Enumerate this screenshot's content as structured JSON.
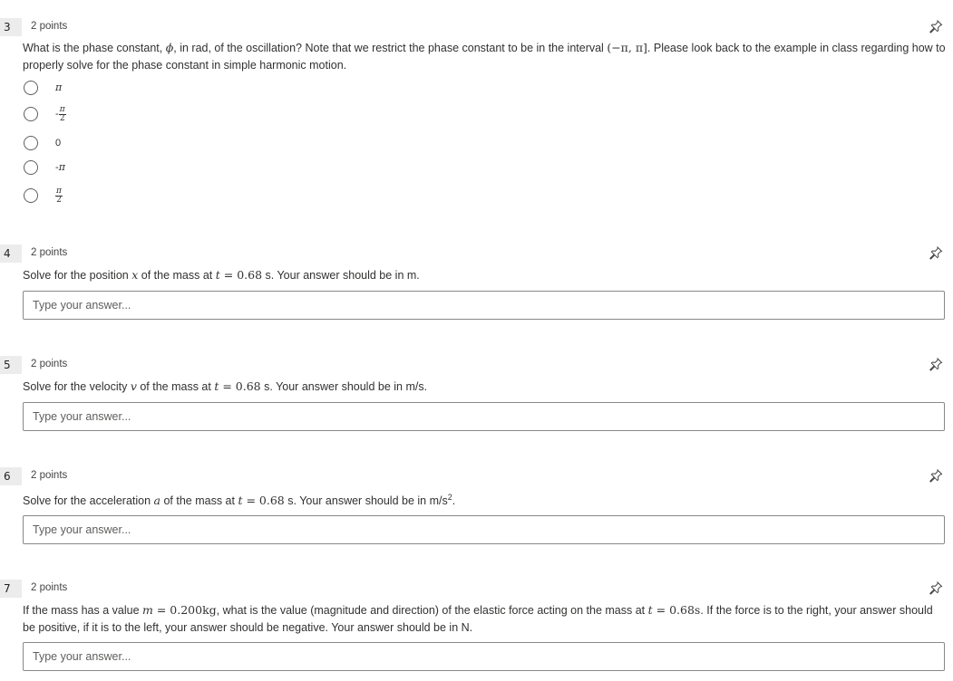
{
  "q3": {
    "number": "3",
    "points": "2 points",
    "text_pre": "What is the phase constant, ",
    "phi": "ϕ",
    "text_mid": ", in rad, of the oscillation? Note that we restrict the phase constant to be in the interval ",
    "interval": "(−π, π]",
    "text_post": ". Please look back to the example in class regarding how to properly solve for the phase constant in simple harmonic motion.",
    "options": {
      "a": {
        "label": "π"
      },
      "b": {
        "sign": "-",
        "num": "π",
        "den": "2"
      },
      "c": {
        "label": "0"
      },
      "d": {
        "label": "-π"
      },
      "e": {
        "num": "π",
        "den": "2"
      }
    }
  },
  "q4": {
    "number": "4",
    "points": "2 points",
    "text_pre": "Solve for the position ",
    "var": "x",
    "text_mid": " of the mass at ",
    "t": "t",
    "eq": " = 0.68",
    "text_post": " s. Your answer should be in m.",
    "placeholder": "Type your answer..."
  },
  "q5": {
    "number": "5",
    "points": "2 points",
    "text_pre": "Solve for the velocity ",
    "var": "v",
    "text_mid": " of the mass at ",
    "t": "t",
    "eq": " = 0.68",
    "text_post": " s. Your answer should be in m/s.",
    "placeholder": "Type your answer..."
  },
  "q6": {
    "number": "6",
    "points": "2 points",
    "text_pre": "Solve for the acceleration ",
    "var": "a",
    "text_mid": " of the mass at ",
    "t": "t",
    "eq": " = 0.68",
    "text_post": " s. Your answer should be in m/s",
    "sup": "2",
    "end": ".",
    "placeholder": "Type your answer..."
  },
  "q7": {
    "number": "7",
    "points": "2 points",
    "text_pre": "If the mass has a value ",
    "m": "m",
    "m_eq": " = 0.200kg",
    "text_mid": ", what is the value (magnitude and direction) of the elastic force acting on the mass at ",
    "t": "t",
    "t_eq": " = 0.68s",
    "text_post": ". If the force is to the right, your answer should be positive, if it is to the left, your answer should be negative. Your answer should be in N.",
    "placeholder": "Type your answer..."
  },
  "icons": {
    "pin": "pin-icon",
    "radio": "radio-circle"
  },
  "colors": {
    "text": "#323130",
    "number_badge": "#ececec",
    "border": "#8a8886"
  }
}
